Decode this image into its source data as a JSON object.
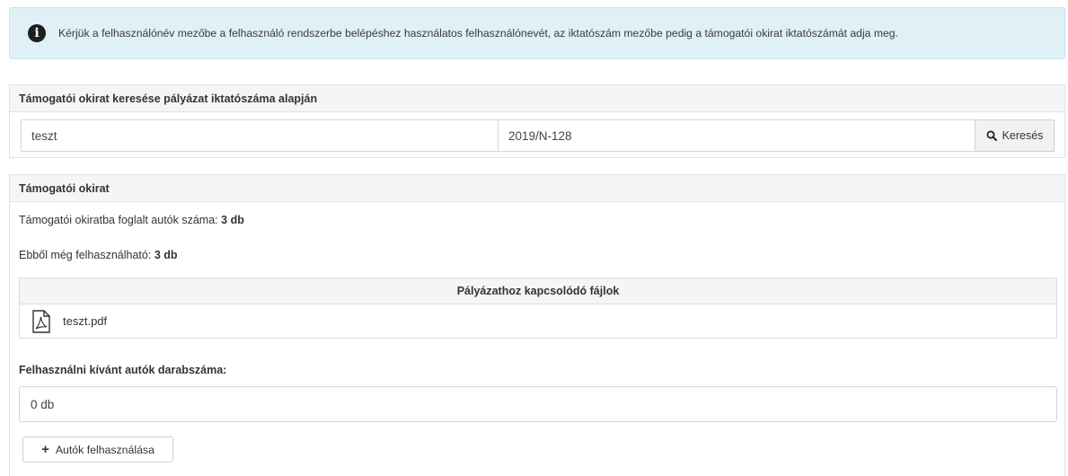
{
  "alert": {
    "icon": "info-icon",
    "text": "Kérjük a felhasználónév mezőbe a felhasználó rendszerbe belépéshez használatos felhasználónevét, az iktatószám mezőbe pedig a támogatói okirat iktatószámát adja meg."
  },
  "search": {
    "heading": "Támogatói okirat keresése pályázat iktatószáma alapján",
    "username_value": "teszt",
    "iktatoszam_value": "2019/N-128",
    "button_label": "Keresés",
    "button_icon": "search-icon"
  },
  "okirat": {
    "heading": "Támogatói okirat",
    "cars_total_label": "Támogatói okiratba foglalt autók száma:",
    "cars_total_value": "3 db",
    "cars_available_label": "Ebből még felhasználható:",
    "cars_available_value": "3 db",
    "files_header": "Pályázathoz kapcsolódó fájlok",
    "files": [
      {
        "name": "teszt.pdf",
        "icon": "pdf-file-icon"
      }
    ],
    "count_label": "Felhasználni kívánt autók darabszáma:",
    "count_value": "0 db",
    "use_button_label": "Autók felhasználása",
    "use_button_icon": "plus-icon"
  }
}
